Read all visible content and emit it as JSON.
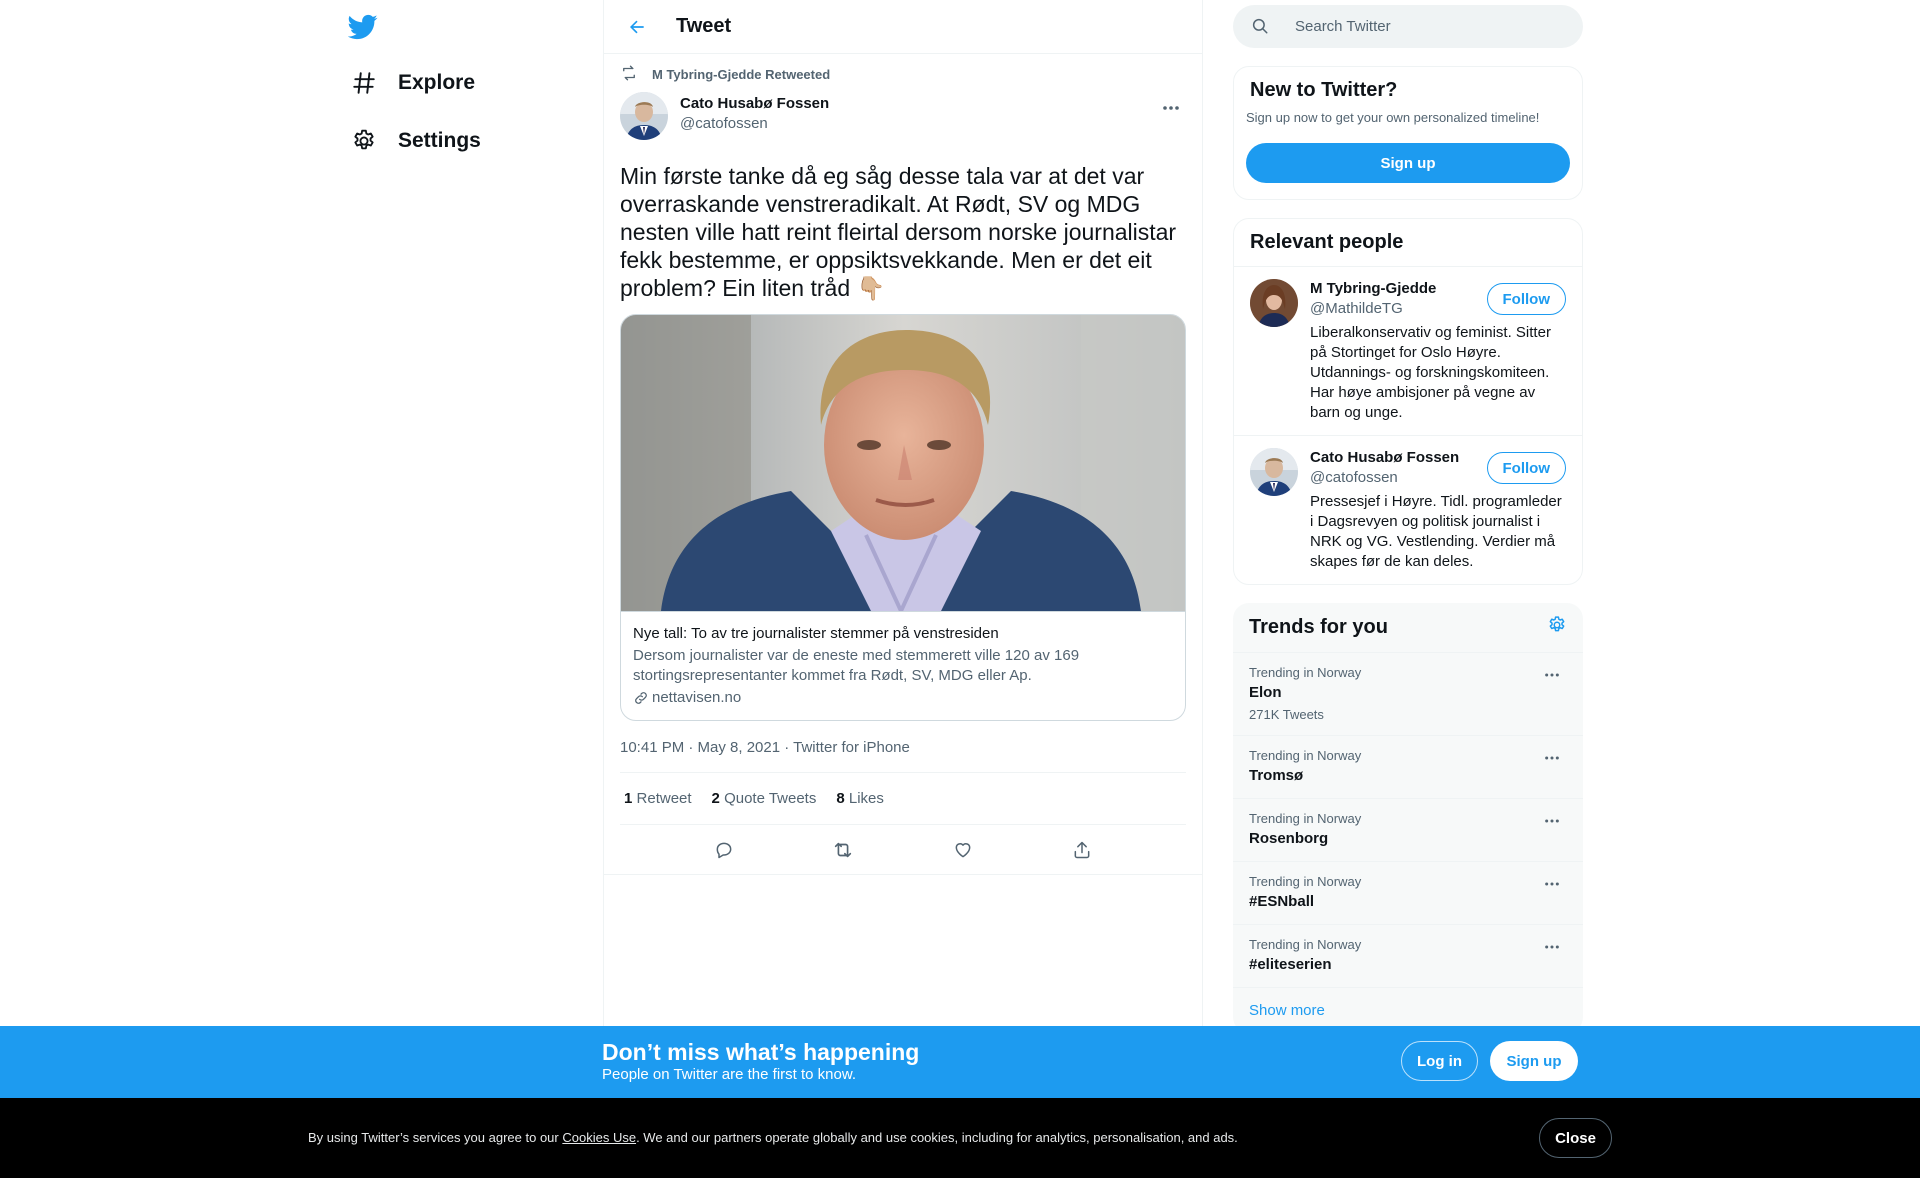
{
  "nav": {
    "items": [
      {
        "label": "Explore",
        "icon": "hashtag-icon"
      },
      {
        "label": "Settings",
        "icon": "gear-icon"
      }
    ]
  },
  "header": {
    "title": "Tweet"
  },
  "tweet": {
    "retweeted_by": "M Tybring-Gjedde Retweeted",
    "author_name": "Cato Husabø Fossen",
    "author_handle": "@catofossen",
    "text": "Min første tanke då eg såg desse tala var at det var overraskande venstreradikalt. At Rødt, SV og MDG nesten ville hatt reint fleirtal dersom norske journalistar fekk bestemme, er oppsiktsvekkande. Men er det eit problem? Ein liten tråd 👇🏼",
    "card": {
      "title": "Nye tall: To av tre journalister stemmer på venstresiden",
      "description": "Dersom journalister var de eneste med stemmerett ville 120 av 169 stortingsrepresentanter kommet fra Rødt, SV, MDG eller Ap.",
      "domain": "nettavisen.no"
    },
    "timestamp": "10:41 PM · May 8, 2021 · Twitter for iPhone",
    "stats": {
      "retweets_num": "1",
      "retweets_label": "Retweet",
      "quotes_num": "2",
      "quotes_label": "Quote Tweets",
      "likes_num": "8",
      "likes_label": "Likes"
    }
  },
  "search": {
    "placeholder": "Search Twitter"
  },
  "new_to_twitter": {
    "title": "New to Twitter?",
    "subtitle": "Sign up now to get your own personalized timeline!",
    "button": "Sign up"
  },
  "relevant_people": {
    "title": "Relevant people",
    "people": [
      {
        "name": "M Tybring-Gjedde",
        "handle": "@MathildeTG",
        "bio": "Liberalkonservativ og feminist. Sitter på Stortinget for Oslo Høyre. Utdannings- og forskningskomiteen. Har høye ambisjoner på vegne av barn og unge.",
        "follow": "Follow"
      },
      {
        "name": "Cato Husabø Fossen",
        "handle": "@catofossen",
        "bio": "Pressesjef i Høyre. Tidl. programleder i Dagsrevyen og politisk journalist i NRK og VG. Vestlending. Verdier må skapes før de kan deles.",
        "follow": "Follow"
      }
    ]
  },
  "trends": {
    "title": "Trends for you",
    "items": [
      {
        "meta": "Trending in Norway",
        "name": "Elon",
        "count": "271K Tweets"
      },
      {
        "meta": "Trending in Norway",
        "name": "Tromsø",
        "count": ""
      },
      {
        "meta": "Trending in Norway",
        "name": "Rosenborg",
        "count": ""
      },
      {
        "meta": "Trending in Norway",
        "name": "#ESNball",
        "count": ""
      },
      {
        "meta": "Trending in Norway",
        "name": "#eliteserien",
        "count": ""
      }
    ],
    "show_more": "Show more"
  },
  "signup_bar": {
    "title": "Don’t miss what’s happening",
    "subtitle": "People on Twitter are the first to know.",
    "login": "Log in",
    "signup": "Sign up"
  },
  "cookie": {
    "prefix": "By using Twitter’s services you agree to our ",
    "link": "Cookies Use",
    "suffix": ". We and our partners operate globally and use cookies, including for analytics, personalisation, and ads.",
    "close": "Close"
  },
  "colors": {
    "accent": "#1d9bf0",
    "text": "#0f1419",
    "secondary": "#536471"
  }
}
